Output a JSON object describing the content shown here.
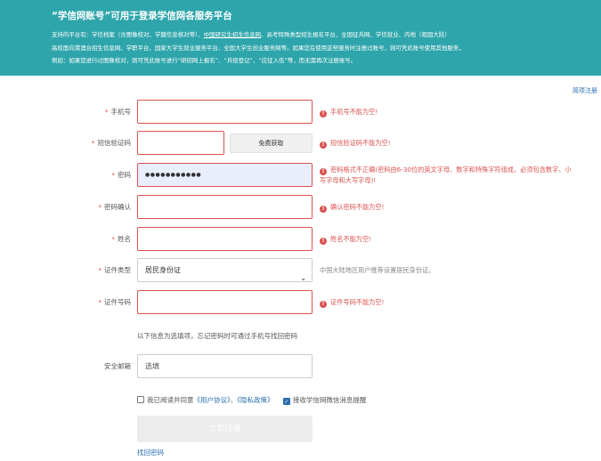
{
  "banner": {
    "title": "“学信网账号”可用于登录学信网各服务平台",
    "line1_pre": "支持的平台有：学信档案（含图像校对、学籍信息核对等）、",
    "line1_link": "中国研究生招生信息网",
    "line1_post": "、高考特殊类型招生报名平台、全国征兵网、学信就业、内地（祖国大陆）",
    "line2": "高校面向港澳台招生信息网、学职平台、国家大学生就业服务平台、全国大学生创业服务网等。如果您在使用这些服务时注册过账号，则可凭此账号使用其他服务，",
    "line3": "例如：如果您进行过图像校对，则可凭此账号进行“研招网上报名”、“兵役登记”、“应征入伍”等，而无需再次注册账号。"
  },
  "simple_register": "简项注册",
  "phone": {
    "label": "手机号",
    "value": "",
    "error": "手机号不能为空!"
  },
  "sms": {
    "label": "短信验证码",
    "value": "",
    "button": "免费获取",
    "error": "短信验证码不能为空!"
  },
  "password": {
    "label": "密码",
    "value": "●●●●●●●●●●●",
    "error_line1": "密码格式不正确(密码由6-30位的英文字母、数字和特殊字符组成，必须包含数字、小",
    "error_line2": "写字母和大写字母)!"
  },
  "password_confirm": {
    "label": "密码确认",
    "value": "",
    "error": "确认密码不能为空!"
  },
  "name": {
    "label": "姓名",
    "value": "",
    "error": "姓名不能为空!"
  },
  "id_type": {
    "label": "证件类型",
    "value": "居民身份证",
    "hint": "中国大陆地区用户推荐设置居民身份证。"
  },
  "id_number": {
    "label": "证件号码",
    "value": "",
    "error": "证件号码不能为空!"
  },
  "optional_note": "以下信息为选填项，忘记密码时可通过手机号找回密码",
  "email": {
    "label": "安全邮箱",
    "placeholder": "选填"
  },
  "agree": {
    "pre": "我已阅读并同意",
    "user_agreement": "《用户协议》",
    "sep": "、",
    "privacy": "《隐私政策》",
    "wechat": "接收学信网微信消息提醒"
  },
  "submit": "立即注册",
  "find_password": "找回密码"
}
